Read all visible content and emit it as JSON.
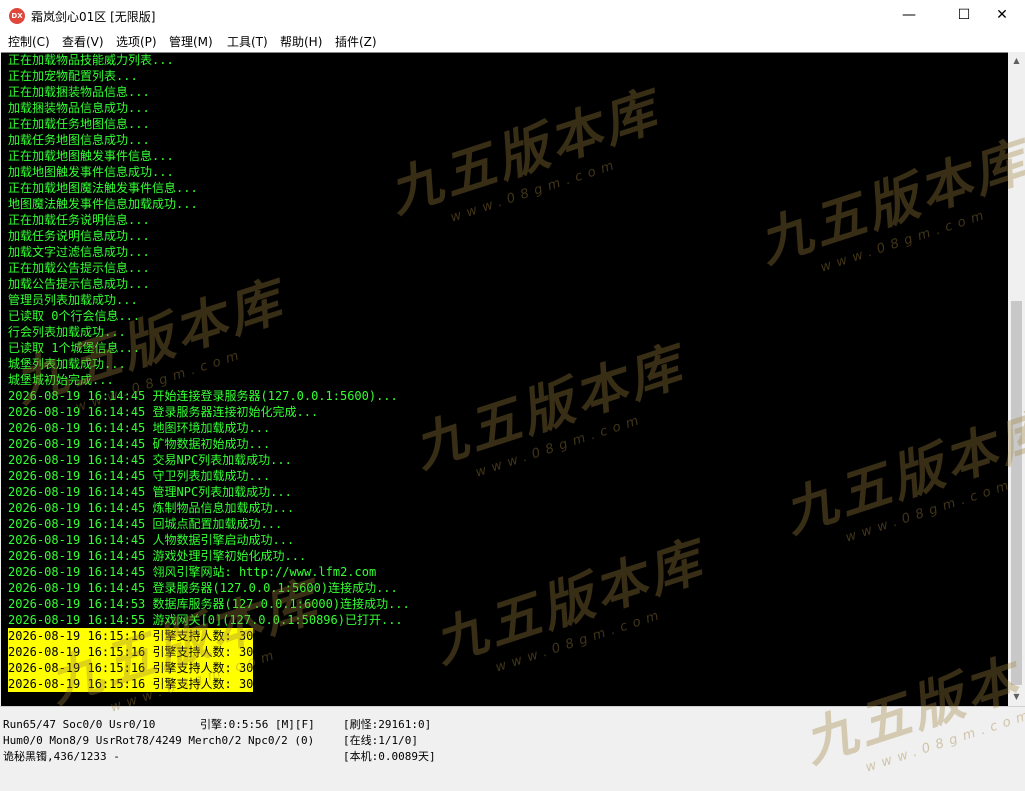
{
  "window": {
    "title": "霜岚剑心01区 [无限版]",
    "icon_label": "DX",
    "controls": {
      "minimize": "—",
      "maximize": "☐",
      "close": "✕"
    }
  },
  "menu": [
    {
      "label": "控制(C)"
    },
    {
      "label": "查看(V)"
    },
    {
      "label": "选项(P)"
    },
    {
      "label": "管理(M)"
    },
    {
      "label": "工具(T)"
    },
    {
      "label": "帮助(H)"
    },
    {
      "label": "插件(Z)"
    }
  ],
  "console": {
    "text_color": "#33ff33",
    "highlight_bg": "#ffff00",
    "lines": [
      {
        "text": "正在加载物品技能威力列表..."
      },
      {
        "text": "正在加宠物配置列表..."
      },
      {
        "text": "正在加载捆装物品信息..."
      },
      {
        "text": "加载捆装物品信息成功..."
      },
      {
        "text": "正在加载任务地图信息..."
      },
      {
        "text": "加载任务地图信息成功..."
      },
      {
        "text": "正在加载地图触发事件信息..."
      },
      {
        "text": "加载地图触发事件信息成功..."
      },
      {
        "text": "正在加载地图魔法触发事件信息..."
      },
      {
        "text": "地图魔法触发事件信息加载成功..."
      },
      {
        "text": "正在加载任务说明信息..."
      },
      {
        "text": "加载任务说明信息成功..."
      },
      {
        "text": "加载文字过滤信息成功..."
      },
      {
        "text": "正在加载公告提示信息..."
      },
      {
        "text": "加载公告提示信息成功..."
      },
      {
        "text": "管理员列表加载成功..."
      },
      {
        "text": "已读取 0个行会信息..."
      },
      {
        "text": "行会列表加载成功..."
      },
      {
        "text": "已读取 1个城堡信息..."
      },
      {
        "text": "城堡列表加载成功..."
      },
      {
        "text": "城堡城初始完成..."
      },
      {
        "text": "2026-08-19 16:14:45 开始连接登录服务器(127.0.0.1:5600)..."
      },
      {
        "text": "2026-08-19 16:14:45 登录服务器连接初始化完成..."
      },
      {
        "text": "2026-08-19 16:14:45 地图环境加载成功..."
      },
      {
        "text": "2026-08-19 16:14:45 矿物数据初始成功..."
      },
      {
        "text": "2026-08-19 16:14:45 交易NPC列表加载成功..."
      },
      {
        "text": "2026-08-19 16:14:45 守卫列表加载成功..."
      },
      {
        "text": "2026-08-19 16:14:45 管理NPC列表加载成功..."
      },
      {
        "text": "2026-08-19 16:14:45 炼制物品信息加载成功..."
      },
      {
        "text": "2026-08-19 16:14:45 回城点配置加载成功..."
      },
      {
        "text": "2026-08-19 16:14:45 人物数据引擎启动成功..."
      },
      {
        "text": "2026-08-19 16:14:45 游戏处理引擎初始化成功..."
      },
      {
        "text": "2026-08-19 16:14:45 翎风引擎网站: http://www.lfm2.com"
      },
      {
        "text": "2026-08-19 16:14:45 登录服务器(127.0.0.1:5600)连接成功..."
      },
      {
        "text": "2026-08-19 16:14:53 数据库服务器(127.0.0.1:6000)连接成功..."
      },
      {
        "text": "2026-08-19 16:14:55 游戏网关[0](127.0.0.1:50896)已打开..."
      },
      {
        "text": "2026-08-19 16:15:16 引擎支持人数: 30",
        "highlight": true
      },
      {
        "text": "2026-08-19 16:15:16 引擎支持人数: 30",
        "highlight": true
      },
      {
        "text": "2026-08-19 16:15:16 引擎支持人数: 30",
        "highlight": true
      },
      {
        "text": "2026-08-19 16:15:16 引擎支持人数: 30",
        "highlight": true
      }
    ]
  },
  "scrollbar": {
    "up": "▲",
    "down": "▼"
  },
  "status": {
    "row1_left": "Run65/47 Soc0/0 Usr0/10",
    "row1_mid": "引擎:0:5:56 [M][F]",
    "row1_right": "[刷怪:29161:0]",
    "row2_left": "Hum0/0 Mon8/9 UsrRot78/4249 Merch0/2 Npc0/2 (0)",
    "row2_right": "[在线:1/1/0]",
    "row3_left": "诡秘黑镯,436/1233 -",
    "row3_right": "[本机:0.0089天]"
  },
  "watermark": {
    "brand": "九五版本库",
    "url": "www.08gm.com",
    "color": "#a0823c"
  }
}
